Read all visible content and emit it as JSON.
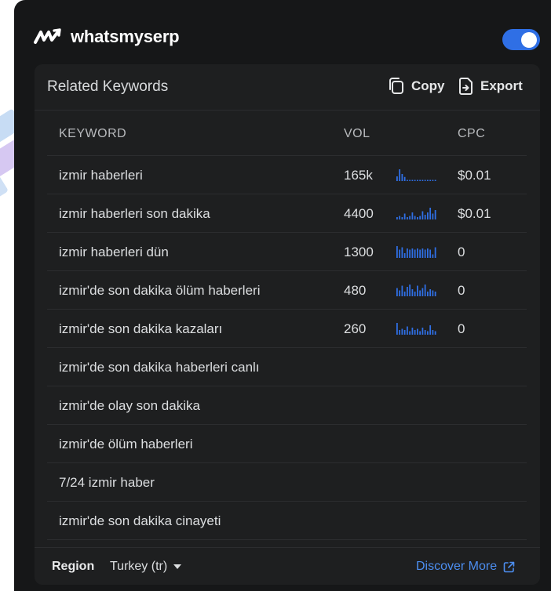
{
  "app": {
    "brand": "whatsmyserp",
    "toggle_on": true,
    "colors": {
      "accent": "#2f6fe5",
      "link": "#4c8ef0",
      "panel": "#161718",
      "card": "#1e1f20"
    }
  },
  "card": {
    "title": "Related Keywords",
    "copy_label": "Copy",
    "export_label": "Export"
  },
  "table": {
    "headers": {
      "keyword": "KEYWORD",
      "vol": "VOL",
      "cpc": "CPC"
    },
    "rows": [
      {
        "keyword": "izmir haberleri",
        "vol": "165k",
        "cpc": "$0.01",
        "trend": [
          0.4,
          1.0,
          0.6,
          0.35,
          0.1,
          0.1,
          0.1,
          0.1,
          0.1,
          0.1,
          0.1,
          0.1,
          0.1,
          0.1,
          0.1,
          0.1
        ]
      },
      {
        "keyword": "izmir haberleri son dakika",
        "vol": "4400",
        "cpc": "$0.01",
        "trend": [
          0.2,
          0.3,
          0.2,
          0.5,
          0.2,
          0.3,
          0.6,
          0.3,
          0.2,
          0.3,
          0.7,
          0.4,
          0.6,
          1.0,
          0.5,
          0.8
        ]
      },
      {
        "keyword": "izmir haberleri dün",
        "vol": "1300",
        "cpc": "0",
        "trend": [
          1.0,
          0.7,
          0.9,
          0.4,
          0.8,
          0.7,
          0.8,
          0.7,
          0.8,
          0.7,
          0.8,
          0.7,
          0.8,
          0.7,
          0.3,
          0.9
        ]
      },
      {
        "keyword": "izmir'de son dakika ölüm haberleri",
        "vol": "480",
        "cpc": "0",
        "trend": [
          0.7,
          0.5,
          0.9,
          0.4,
          0.8,
          1.0,
          0.6,
          0.4,
          0.9,
          0.5,
          0.7,
          1.0,
          0.4,
          0.6,
          0.5,
          0.4
        ]
      },
      {
        "keyword": "izmir'de son dakika kazaları",
        "vol": "260",
        "cpc": "0",
        "trend": [
          1.0,
          0.4,
          0.5,
          0.4,
          0.7,
          0.3,
          0.6,
          0.4,
          0.5,
          0.3,
          0.6,
          0.4,
          0.3,
          0.8,
          0.4,
          0.3
        ]
      },
      {
        "keyword": "izmir'de son dakika haberleri canlı",
        "vol": "",
        "cpc": "",
        "trend": []
      },
      {
        "keyword": "izmir'de olay son dakika",
        "vol": "",
        "cpc": "",
        "trend": []
      },
      {
        "keyword": "izmir'de ölüm haberleri",
        "vol": "",
        "cpc": "",
        "trend": []
      },
      {
        "keyword": "7/24 izmir haber",
        "vol": "",
        "cpc": "",
        "trend": []
      },
      {
        "keyword": "izmir'de son dakika cinayeti",
        "vol": "",
        "cpc": "",
        "trend": []
      }
    ]
  },
  "footer": {
    "region_label": "Region",
    "region_value": "Turkey (tr)",
    "discover_label": "Discover More"
  }
}
